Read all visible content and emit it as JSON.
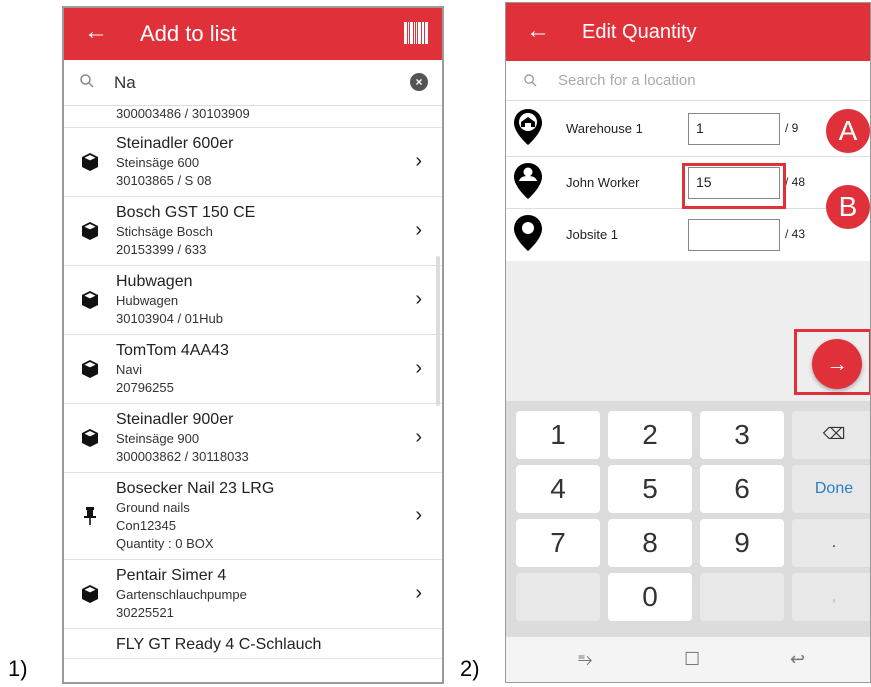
{
  "labels": {
    "fig1": "1)",
    "fig2": "2)"
  },
  "screen1": {
    "title": "Add to list",
    "back_icon": "arrow-left-icon",
    "barcode_icon": "barcode-icon",
    "search_value": "Na",
    "partial_top": "300003486 / 30103909",
    "items": [
      {
        "name": "Steinadler 600er",
        "lines": [
          "Steinsäge 600",
          "30103865 / S 08"
        ],
        "icon": "box-icon"
      },
      {
        "name": "Bosch GST 150 CE",
        "lines": [
          "Stichsäge Bosch",
          "20153399 / 633"
        ],
        "icon": "box-icon"
      },
      {
        "name": "Hubwagen",
        "lines": [
          "Hubwagen",
          "30103904 / 01Hub"
        ],
        "icon": "box-icon"
      },
      {
        "name": "TomTom 4AA43",
        "lines": [
          "Navi",
          "20796255"
        ],
        "icon": "box-icon"
      },
      {
        "name": "Steinadler 900er",
        "lines": [
          "Steinsäge 900",
          "300003862 / 30118033"
        ],
        "icon": "box-icon"
      },
      {
        "name": "Bosecker Nail 23 LRG",
        "lines": [
          "Ground nails",
          "Con12345",
          "Quantity : 0 BOX"
        ],
        "icon": "pushpin-icon"
      },
      {
        "name": "Pentair Simer 4",
        "lines": [
          "Gartenschlauchpumpe",
          "30225521"
        ],
        "icon": "box-icon"
      }
    ],
    "partial_bottom": "FLY GT Ready 4 C-Schlauch"
  },
  "screen2": {
    "title": "Edit Quantity",
    "back_icon": "arrow-left-icon",
    "search_placeholder": "Search for a location",
    "locations": [
      {
        "name": "Warehouse 1",
        "qty": "1",
        "max": "/ 9",
        "icon": "warehouse-pin-icon"
      },
      {
        "name": "John Worker",
        "qty": "15",
        "max": "/ 48",
        "icon": "person-pin-icon"
      },
      {
        "name": "Jobsite 1",
        "qty": "",
        "max": "/ 43",
        "icon": "location-pin-icon"
      }
    ],
    "badge_a": "A",
    "badge_b": "B",
    "fab_icon": "arrow-right-icon",
    "fab_glyph": "→",
    "keys": {
      "k1": "1",
      "k2": "2",
      "k3": "3",
      "k4": "4",
      "k5": "5",
      "k6": "6",
      "k7": "7",
      "k8": "8",
      "k9": "9",
      "k0": "0",
      "backspace": "⌫",
      "done": "Done",
      "dot": ".",
      "comma": ","
    },
    "nav": {
      "recent": "⥱",
      "home": "☐",
      "back": "↩"
    },
    "accent": "#e0303a"
  }
}
